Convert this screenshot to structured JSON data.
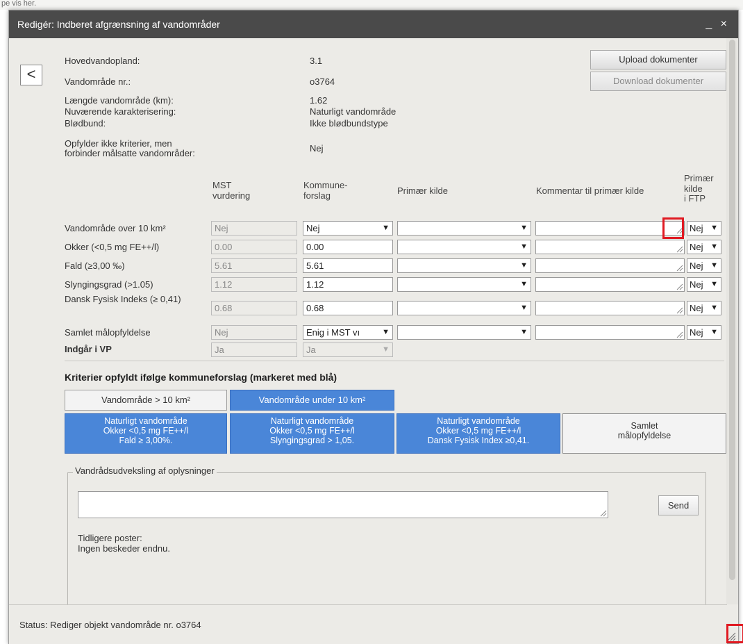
{
  "dialog": {
    "title": "Redigér: Indberet afgrænsning af vandområder",
    "window_controls": "_ ×"
  },
  "top_strip_text": "pe vis her.",
  "back_label": "<",
  "buttons": {
    "upload": "Upload dokumenter",
    "download": "Download dokumenter",
    "send": "Send"
  },
  "info": [
    {
      "label": "Hovedvandopland:",
      "value": "3.1"
    },
    {
      "label": "Vandområde nr.:",
      "value": "o3764"
    },
    {
      "label": "Længde vandområde (km):",
      "value": "1.62"
    },
    {
      "label": "Nuværende karakterisering:",
      "value": "Naturligt vandområde"
    },
    {
      "label": "Blødbund:",
      "value": "Ikke blødbundstype"
    },
    {
      "label_line1": "Opfylder ikke kriterier, men",
      "label_line2": "forbinder målsatte vandområder:",
      "value": "Nej"
    }
  ],
  "columns": {
    "mst_line1": "MST",
    "mst_line2": "vurdering",
    "kommune_line1": "Kommune-",
    "kommune_line2": "forslag",
    "primaer_kilde": "Primær kilde",
    "kommentar": "Kommentar til primær kilde",
    "ftp_line1": "Primær",
    "ftp_line2": "kilde",
    "ftp_line3": "i FTP"
  },
  "rows": [
    {
      "label": "Vandområde over 10 km²",
      "mst": "Nej",
      "kommune": "Nej",
      "ftp": "Nej"
    },
    {
      "label": "Okker (<0,5 mg FE++/l)",
      "mst": "0.00",
      "kommune": "0.00",
      "ftp": "Nej"
    },
    {
      "label": "Fald (≥3,00 ‰)",
      "mst": "5.61",
      "kommune": "5.61",
      "ftp": "Nej"
    },
    {
      "label": "Slyngingsgrad (>1.05)",
      "mst": "1.12",
      "kommune": "1.12",
      "ftp": "Nej"
    },
    {
      "label": "Dansk Fysisk Indeks (≥ 0,41)",
      "mst": "0.68",
      "kommune": "0.68",
      "ftp": "Nej"
    },
    {
      "label": "Samlet målopfyldelse",
      "mst": "Nej",
      "kommune": "Enig i MST vı",
      "ftp": "Nej"
    }
  ],
  "vp_row": {
    "label": "Indgår i VP",
    "mst": "Ja",
    "kommune": "Ja"
  },
  "criteria": {
    "heading": "Kriterier opfyldt ifølge kommuneforslag (markeret med blå)",
    "tab_over": "Vandområde > 10 km²",
    "tab_under": "Vandområde under 10 km²",
    "box1": [
      "Naturligt vandområde",
      "Okker <0,5 mg FE++/l",
      "Fald ≥ 3,00%."
    ],
    "box2": [
      "Naturligt vandområde",
      "Okker <0,5 mg FE++/l",
      "Slyngingsgrad > 1,05."
    ],
    "box3": [
      "Naturligt vandområde",
      "Okker <0,5 mg FE++/l",
      "Dansk Fysisk Index ≥0,41."
    ],
    "box4": [
      "Samlet",
      "målopfyldelse"
    ]
  },
  "exchange": {
    "legend": "Vandrådsudveksling af oplysninger",
    "prev_label": "Tidligere poster:",
    "no_messages": "Ingen beskeder endnu."
  },
  "status": "Status: Rediger objekt vandområde nr. o3764",
  "colors": {
    "titlebar": "#4a4a4a",
    "dialog_bg": "#ecebe7",
    "active_blue": "#4a86d8",
    "highlight_red": "#e01a22"
  }
}
